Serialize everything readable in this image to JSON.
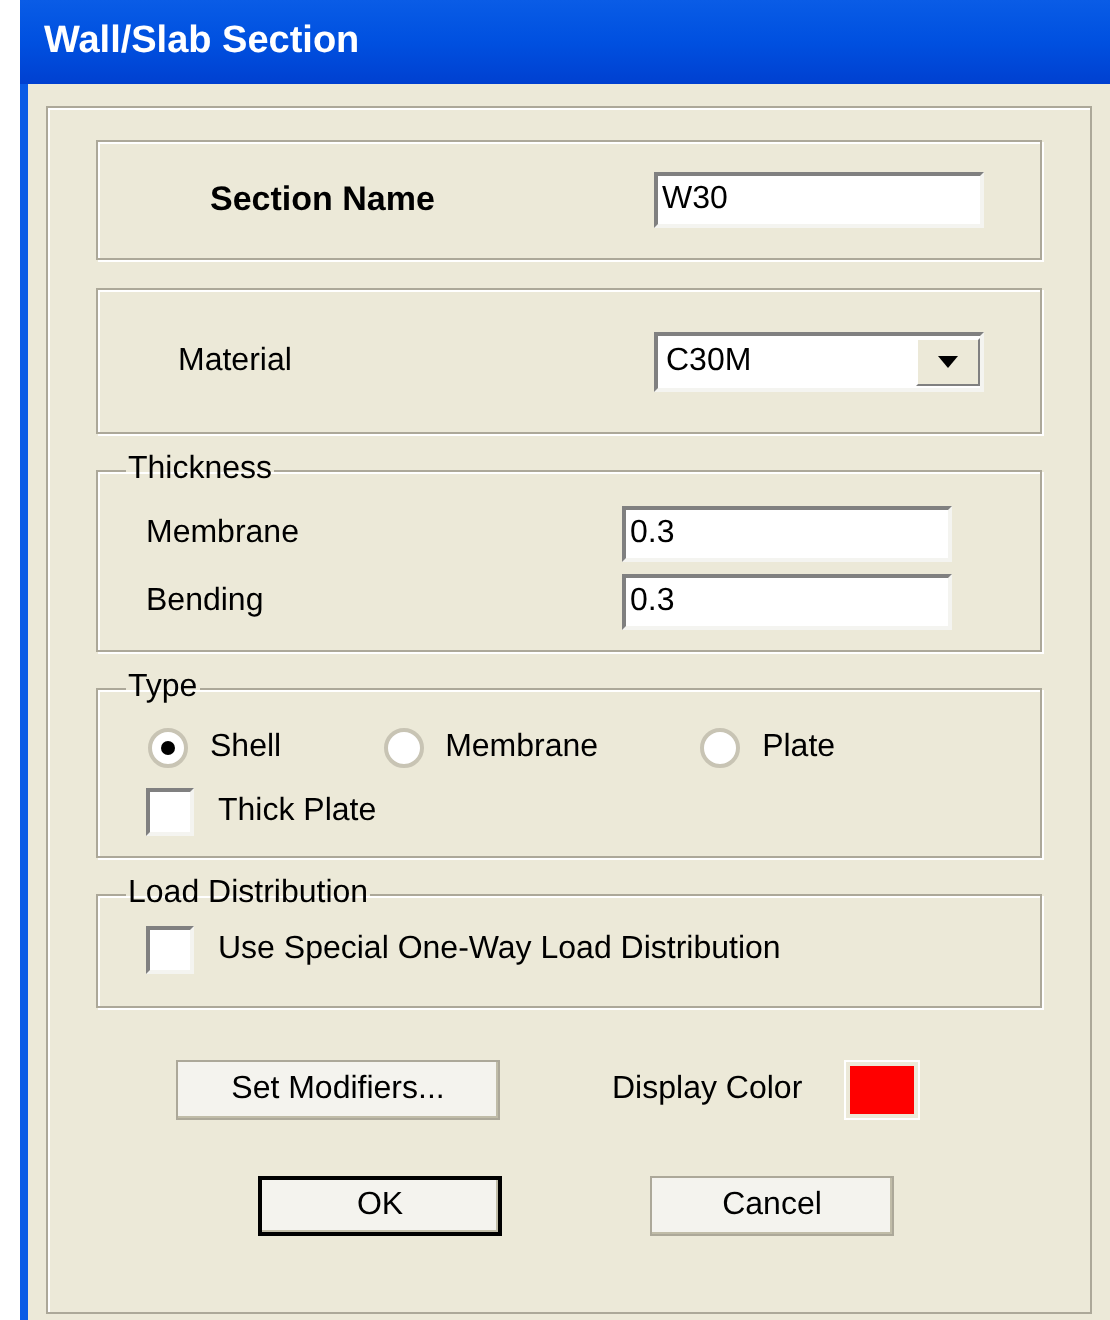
{
  "window": {
    "title": "Wall/Slab Section"
  },
  "section_name": {
    "label": "Section Name",
    "value": "W30"
  },
  "material": {
    "label": "Material",
    "value": "C30M"
  },
  "thickness": {
    "title": "Thickness",
    "fields": [
      {
        "label": "Membrane",
        "value": "0.3"
      },
      {
        "label": "Bending",
        "value": "0.3"
      }
    ]
  },
  "type": {
    "title": "Type",
    "options": [
      {
        "label": "Shell",
        "selected": true
      },
      {
        "label": "Membrane",
        "selected": false
      },
      {
        "label": "Plate",
        "selected": false
      }
    ],
    "thick_plate": {
      "label": "Thick Plate",
      "checked": false
    }
  },
  "load_distribution": {
    "title": "Load Distribution",
    "option": {
      "label": "Use Special One-Way Load Distribution",
      "checked": false
    }
  },
  "modifiers_button": "Set Modifiers...",
  "display_color": {
    "label": "Display Color",
    "color": "#ff0000"
  },
  "buttons": [
    {
      "label": "OK",
      "default": true
    },
    {
      "label": "Cancel",
      "default": false
    }
  ]
}
